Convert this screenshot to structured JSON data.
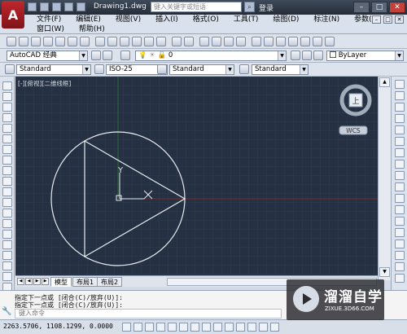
{
  "app": {
    "title": "Drawing1.dwg",
    "logo_letter": "A",
    "search_placeholder": "键入关键字或短语",
    "login_label": "登录"
  },
  "menu": {
    "row1": [
      "文件(F)",
      "编辑(E)",
      "视图(V)",
      "插入(I)",
      "格式(O)",
      "工具(T)",
      "绘图(D)",
      "标注(N)",
      "参数(P)"
    ],
    "row2": [
      "窗口(W)",
      "帮助(H)"
    ]
  },
  "toolbars": {
    "workspace": "AutoCAD 经典",
    "layer_value": "0",
    "color_value": "ByLayer",
    "text_style": "Standard",
    "dim_style": "ISO-25",
    "table_style": "Standard",
    "multileader_style": "Standard"
  },
  "viewport": {
    "label": "[-][俯视][二维线框]",
    "axis_y": "Y",
    "axis_x": "X",
    "viewcube_face": "上",
    "wcs": "WCS",
    "colors": {
      "background": "#253142",
      "geometry": "#e8ecef",
      "x_axis": "#7a2a2a",
      "y_axis": "#2f6a37"
    }
  },
  "layout_tabs": [
    "模型",
    "布局1",
    "布局2"
  ],
  "command": {
    "history": [
      "指定下一点或 [闭合(C)/放弃(U)]:",
      "指定下一点或 [闭合(C)/放弃(U)]:"
    ],
    "input_placeholder": "键入命令"
  },
  "status": {
    "coords": "2263.5706, 1108.1299, 0.0000"
  },
  "watermark": {
    "title": "溜溜自学",
    "url": "ZIXUE.3D66.COM"
  }
}
